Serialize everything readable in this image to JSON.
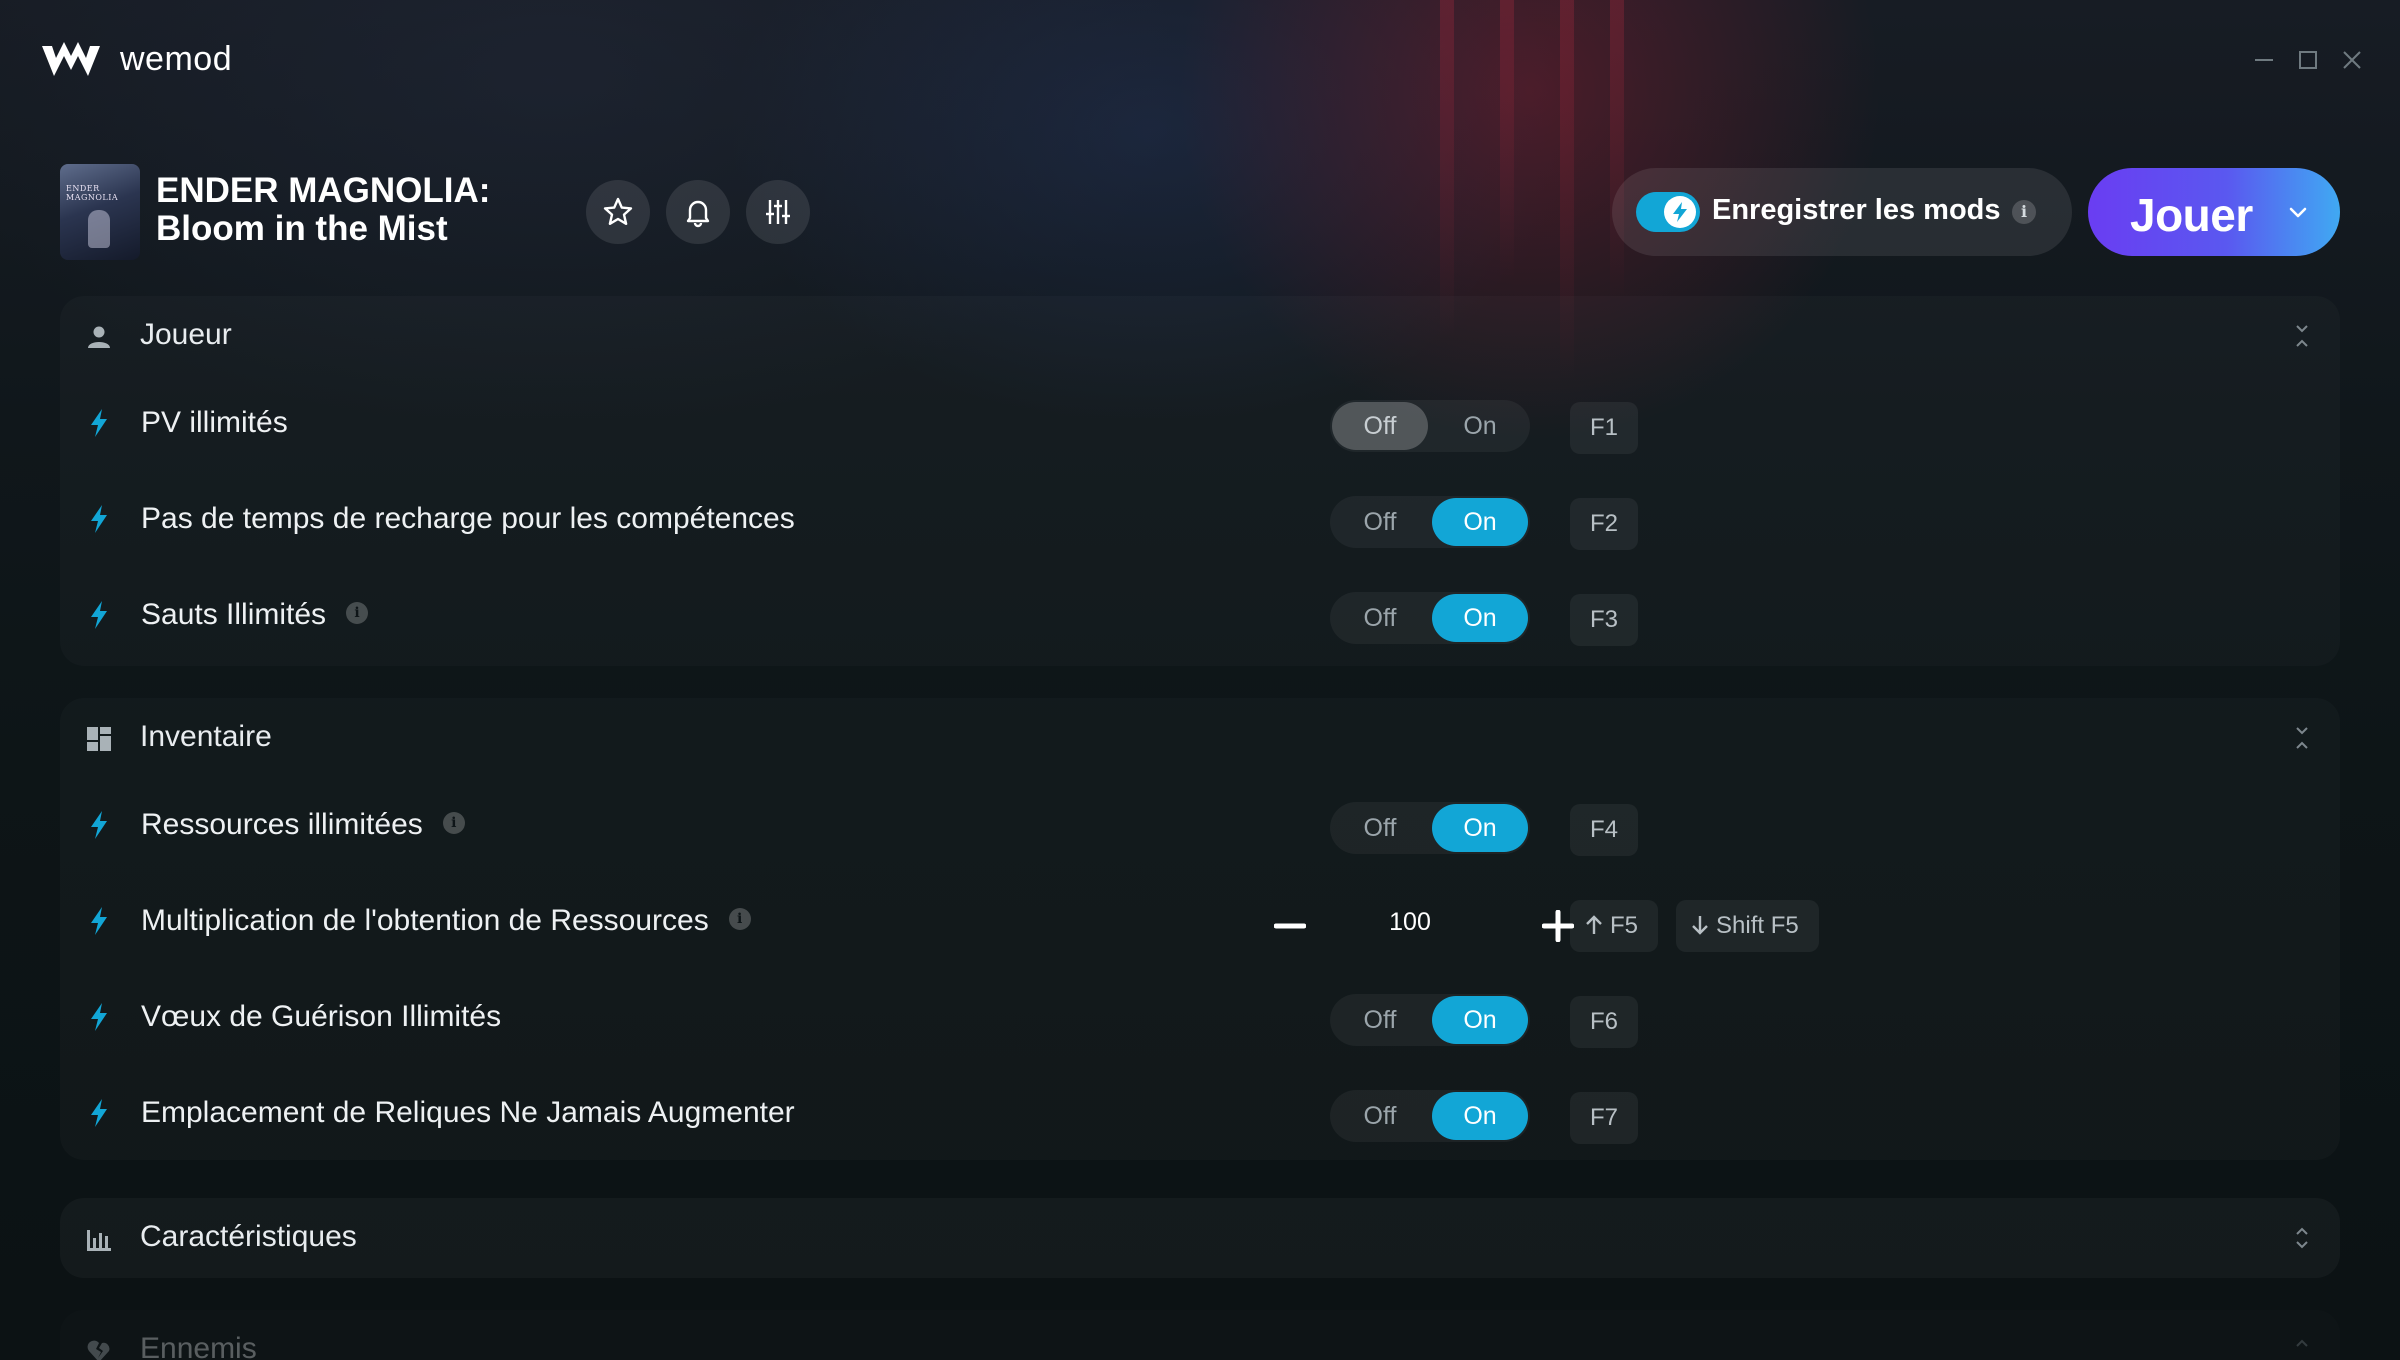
{
  "app": {
    "brand": "wemod"
  },
  "window": {
    "minimize": "minimize-icon",
    "maximize": "maximize-icon",
    "close": "close-icon"
  },
  "game": {
    "cover_text": "ENDER MAGNOLIA",
    "title_line1": "ENDER MAGNOLIA:",
    "title_line2": "Bloom in the Mist"
  },
  "header_buttons": [
    "star-icon",
    "bell-icon",
    "sliders-icon"
  ],
  "save_mods": {
    "label": "Enregistrer les mods",
    "enabled": true,
    "info": "i"
  },
  "play": {
    "label": "Jouer"
  },
  "colors": {
    "accent": "#12a6d6",
    "play_start": "#6a3df2",
    "play_end": "#40a9f2"
  },
  "sections": {
    "player": {
      "title": "Joueur",
      "icon": "person-icon",
      "rows": [
        {
          "label": "PV illimités",
          "state": "off",
          "off": "Off",
          "on": "On",
          "key": "F1"
        },
        {
          "label": "Pas de temps de recharge pour les compétences",
          "state": "on",
          "off": "Off",
          "on": "On",
          "key": "F2"
        },
        {
          "label": "Sauts Illimités",
          "info": "i",
          "state": "on",
          "off": "Off",
          "on": "On",
          "key": "F3"
        }
      ]
    },
    "inventory": {
      "title": "Inventaire",
      "icon": "grid-icon",
      "rows": [
        {
          "label": "Ressources illimitées",
          "info": "i",
          "state": "on",
          "off": "Off",
          "on": "On",
          "key": "F4"
        },
        {
          "label": "Multiplication de l'obtention de Ressources",
          "info": "i",
          "value": "100",
          "key_up": "F5",
          "key_down": "Shift F5"
        },
        {
          "label": "Vœux de Guérison Illimités",
          "state": "on",
          "off": "Off",
          "on": "On",
          "key": "F6"
        },
        {
          "label": "Emplacement de Reliques Ne Jamais Augmenter",
          "state": "on",
          "off": "Off",
          "on": "On",
          "key": "F7"
        }
      ]
    },
    "stats": {
      "title": "Caractéristiques",
      "icon": "bar-chart-icon"
    },
    "enemies": {
      "title": "Ennemis",
      "icon": "broken-heart-icon"
    }
  }
}
